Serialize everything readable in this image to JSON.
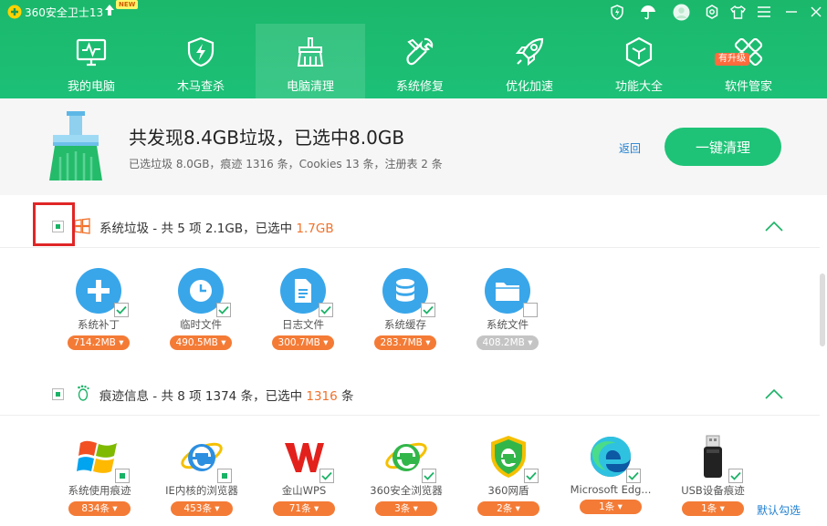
{
  "titlebar": {
    "title": "360安全卫士13",
    "new_badge": "NEW"
  },
  "nav": [
    {
      "label": "我的电脑",
      "icon": "monitor-icon"
    },
    {
      "label": "木马查杀",
      "icon": "shield-icon"
    },
    {
      "label": "电脑清理",
      "icon": "broom-icon"
    },
    {
      "label": "系统修复",
      "icon": "wrench-icon"
    },
    {
      "label": "优化加速",
      "icon": "rocket-icon"
    },
    {
      "label": "功能大全",
      "icon": "cube-icon"
    },
    {
      "label": "软件管家",
      "icon": "apps-icon"
    }
  ],
  "upgrade_badge": "有升级",
  "summary": {
    "title": "共发现8.4GB垃圾，已选中8.0GB",
    "detail": "已选垃圾 8.0GB，痕迹 1316 条，Cookies 13 条，注册表 2 条",
    "back": "返回",
    "clean_button": "一键清理"
  },
  "section1": {
    "title": "系统垃圾 - 共 5 项 2.1GB，已选中 ",
    "highlight": "1.7GB",
    "items": [
      {
        "label": "系统补丁",
        "size": "714.2MB",
        "icon": "puzzle-icon",
        "checked": true
      },
      {
        "label": "临时文件",
        "size": "490.5MB",
        "icon": "clock-icon",
        "checked": true
      },
      {
        "label": "日志文件",
        "size": "300.7MB",
        "icon": "document-icon",
        "checked": true
      },
      {
        "label": "系统缓存",
        "size": "283.7MB",
        "icon": "database-icon",
        "checked": true
      },
      {
        "label": "系统文件",
        "size": "408.2MB",
        "icon": "folder-icon",
        "checked": false
      }
    ]
  },
  "section2": {
    "title": "痕迹信息 - 共 8 项 1374 条，已选中 ",
    "highlight": "1316",
    "suffix": " 条",
    "items": [
      {
        "label": "系统使用痕迹",
        "size": "834条",
        "icon": "windows-icon"
      },
      {
        "label": "IE内核的浏览器",
        "size": "453条",
        "icon": "ie-icon"
      },
      {
        "label": "金山WPS",
        "size": "71条",
        "icon": "wps-icon"
      },
      {
        "label": "360安全浏览器",
        "size": "3条",
        "icon": "360-browser-icon"
      },
      {
        "label": "360网盾",
        "size": "2条",
        "icon": "360-shield-icon"
      },
      {
        "label": "Microsoft Edg...",
        "size": "1条",
        "icon": "edge-icon"
      },
      {
        "label": "USB设备痕迹",
        "size": "1条",
        "icon": "usb-icon"
      }
    ]
  },
  "default_select": "默认勾选",
  "colors": {
    "brand": "#1cbd72",
    "accent": "#f47b36",
    "link": "#1e7fd0"
  }
}
